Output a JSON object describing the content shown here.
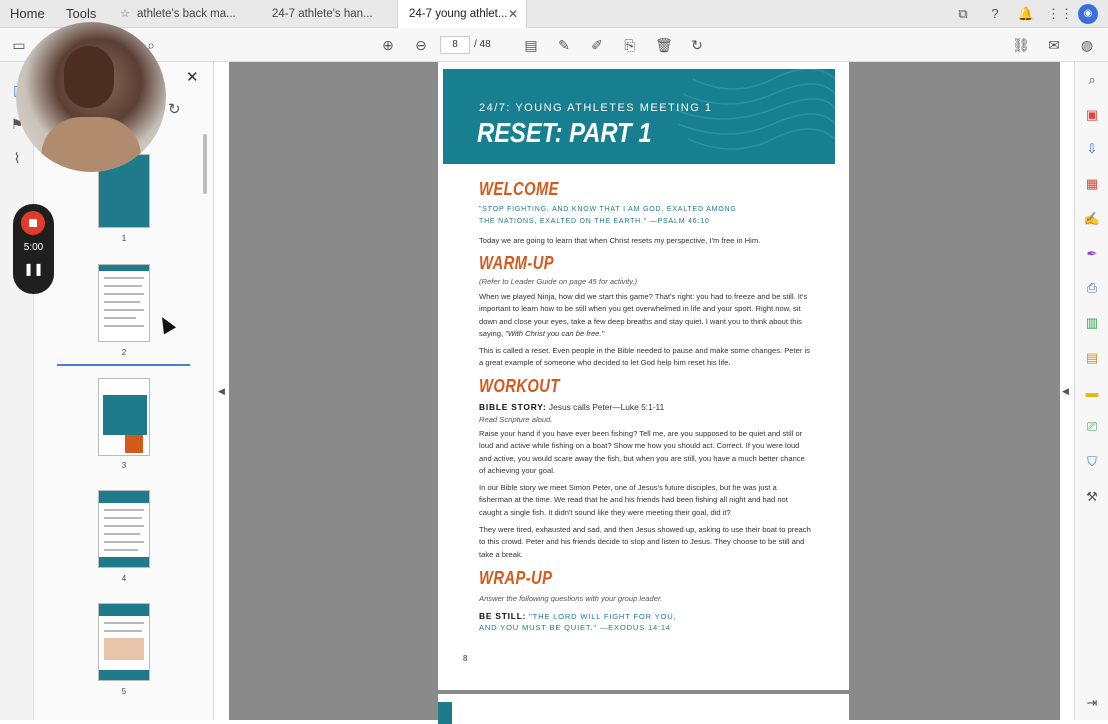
{
  "tabbar": {
    "home": "Home",
    "tools": "Tools",
    "tabs": [
      {
        "label": "athlete's back ma...",
        "icon": "star-icon"
      },
      {
        "label": "24-7 athlete's han...",
        "icon": ""
      },
      {
        "label": "24-7 young athlet...",
        "icon": ""
      }
    ]
  },
  "toolbar": {
    "current_page": "8",
    "page_total": "/ 48"
  },
  "recorder": {
    "time": "5:00"
  },
  "thumbnails": [
    {
      "num": "1"
    },
    {
      "num": "2"
    },
    {
      "num": "3"
    },
    {
      "num": "4"
    },
    {
      "num": "5"
    }
  ],
  "document": {
    "kicker": "24/7: YOUNG ATHLETES MEETING 1",
    "title": "RESET: PART 1",
    "welcome_heading": "WELCOME",
    "welcome_quote_1": "\"STOP FIGHTING, AND KNOW THAT I AM GOD, EXALTED AMONG",
    "welcome_quote_2": "THE NATIONS, EXALTED ON THE EARTH.\" —PSALM 46:10",
    "welcome_body": "Today we are going to learn that when Christ resets my perspective, I'm free in Him.",
    "warmup_heading": "WARM-UP",
    "warmup_note": "(Refer to Leader Guide on page 45 for activity.)",
    "warmup_p1": "When we played Ninja, how did we start this game? That's right: you had to freeze and be still. It's important to learn how to be still when you get overwhelmed in life and your sport. Right now, sit down and close your eyes, take a few deep breaths and stay quiet. I want you to think about this saying, ",
    "warmup_p1_em": "\"With Christ you can be free.\"",
    "warmup_p2": "This is called a reset. Even people in the Bible needed to pause and make some changes. Peter is a great example of someone who decided to let God help him reset his life.",
    "workout_heading": "WORKOUT",
    "bible_story_label": "BIBLE STORY:",
    "bible_story_text": " Jesus calls Peter—Luke 5:1-11",
    "read_scripture": "Read Scripture aloud.",
    "workout_p1": "Raise your hand if you have ever been fishing? Tell me, are you supposed to be quiet and still or loud and active while fishing on a boat? Show me how you should act. Correct. If you were loud and active, you would scare away the fish, but when you are still, you have a much better chance of achieving your goal.",
    "workout_p2": "In our Bible story we meet Simon Peter, one of Jesus's future disciples, but he was just a fisherman at the time. We read that he and his friends had been fishing all night and had not caught a single fish. It didn't sound like they were meeting their goal, did it?",
    "workout_p3": "They were tired, exhausted and sad, and then Jesus showed up, asking to use their boat to preach to this crowd. Peter and his friends decide to stop and listen to Jesus. They choose to be still and take a break.",
    "wrapup_heading": "WRAP-UP",
    "wrapup_note": "Answer the following questions with your group leader.",
    "be_still_label": "BE STILL:",
    "be_still_quote_1": " \"THE LORD WILL FIGHT FOR YOU,",
    "be_still_quote_2": "AND YOU MUST BE QUIET.\" —EXODUS 14:14",
    "page_number": "8"
  },
  "colors": {
    "banner": "#177f8f",
    "heading": "#d35a1a",
    "teal_text": "#1f7a8c"
  }
}
